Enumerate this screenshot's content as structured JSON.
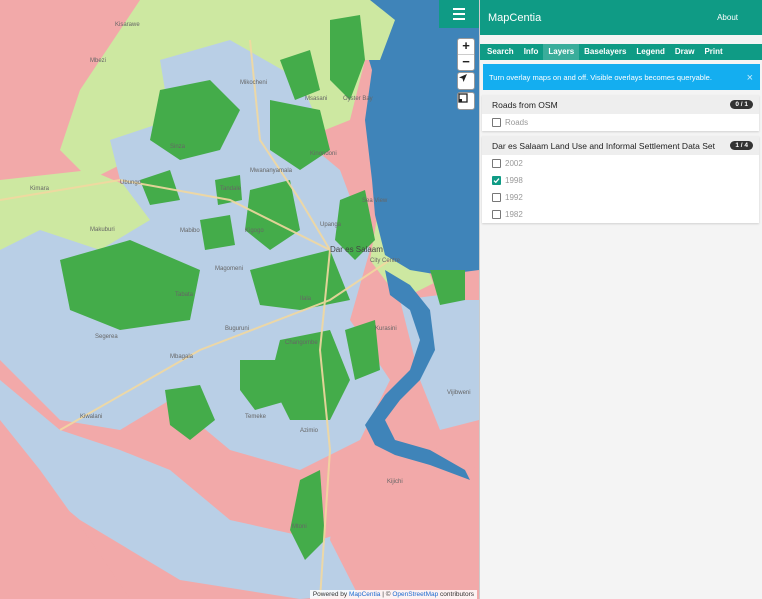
{
  "app": {
    "title": "MapCentia",
    "about_label": "About"
  },
  "tabs": [
    {
      "label": "Search",
      "active": false
    },
    {
      "label": "Info",
      "active": false
    },
    {
      "label": "Layers",
      "active": true
    },
    {
      "label": "Baselayers",
      "active": false
    },
    {
      "label": "Legend",
      "active": false
    },
    {
      "label": "Draw",
      "active": false
    },
    {
      "label": "Print",
      "active": false
    }
  ],
  "notice": {
    "text": "Turn overlay maps on and off. Visible overlays becomes queryable.",
    "close": "×"
  },
  "groups": [
    {
      "title": "Roads from OSM",
      "badge": "0 / 1",
      "layers": [
        {
          "label": "Roads",
          "checked": false
        }
      ]
    },
    {
      "title": "Dar es Salaam Land Use and Informal Settlement Data Set",
      "badge": "1 / 4",
      "layers": [
        {
          "label": "2002",
          "checked": false
        },
        {
          "label": "1998",
          "checked": true
        },
        {
          "label": "1992",
          "checked": false
        },
        {
          "label": "1982",
          "checked": false
        }
      ]
    }
  ],
  "map": {
    "zoom_in": "+",
    "zoom_out": "−",
    "icons": [
      "hamburger-menu-icon",
      "locate-arrow-icon",
      "fullscreen-icon"
    ],
    "place_labels": [
      "Mikocheni",
      "Msasani",
      "Oyster Bay",
      "Sinza",
      "Mwananyamala",
      "Tandale",
      "Kimara",
      "Ubungo",
      "Makuburi",
      "Mabibo",
      "Kigogo",
      "Upanga",
      "Sea View",
      "Dar es Salaam",
      "City Centre",
      "Tabata",
      "Buguruni",
      "Segerea",
      "Changombe",
      "Kiwalani",
      "Temeke",
      "Azimio",
      "Mtoni",
      "Kurasini",
      "Vijibweni",
      "Kijichi",
      "Mbagala",
      "Kisarawe",
      "Magomeni",
      "Ilala",
      "Kinondoni",
      "Mbezi"
    ],
    "attribution": {
      "prefix": "Powered by",
      "brand": "MapCentia",
      "sep": "| ©",
      "osm": "OpenStreetMap",
      "suffix": "contributors"
    }
  },
  "colors": {
    "accent": "#0f9b85",
    "notice": "#14aef0",
    "water": "#3f84b9",
    "settlement": "#b9cfe6",
    "green": "#44ac4a",
    "lightgreen": "#cde8a1",
    "pink": "#f2a9a9"
  }
}
